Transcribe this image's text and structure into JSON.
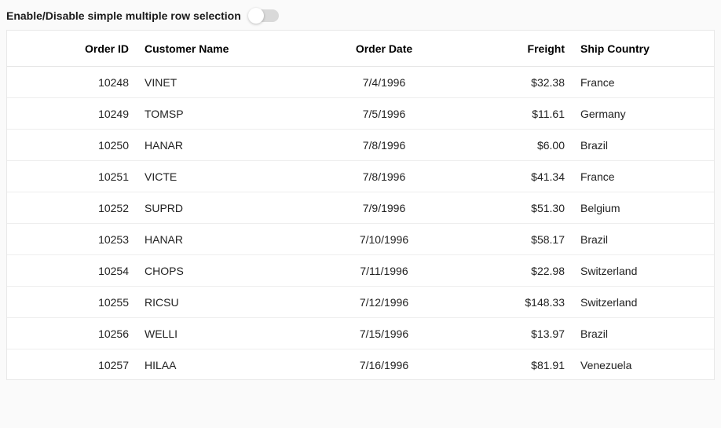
{
  "toggle": {
    "label": "Enable/Disable simple multiple row selection",
    "on": false
  },
  "grid": {
    "columns": {
      "orderId": "Order ID",
      "customer": "Customer Name",
      "orderDate": "Order Date",
      "freight": "Freight",
      "shipCountry": "Ship Country"
    },
    "rows": [
      {
        "orderId": "10248",
        "customer": "VINET",
        "orderDate": "7/4/1996",
        "freight": "$32.38",
        "shipCountry": "France"
      },
      {
        "orderId": "10249",
        "customer": "TOMSP",
        "orderDate": "7/5/1996",
        "freight": "$11.61",
        "shipCountry": "Germany"
      },
      {
        "orderId": "10250",
        "customer": "HANAR",
        "orderDate": "7/8/1996",
        "freight": "$6.00",
        "shipCountry": "Brazil"
      },
      {
        "orderId": "10251",
        "customer": "VICTE",
        "orderDate": "7/8/1996",
        "freight": "$41.34",
        "shipCountry": "France"
      },
      {
        "orderId": "10252",
        "customer": "SUPRD",
        "orderDate": "7/9/1996",
        "freight": "$51.30",
        "shipCountry": "Belgium"
      },
      {
        "orderId": "10253",
        "customer": "HANAR",
        "orderDate": "7/10/1996",
        "freight": "$58.17",
        "shipCountry": "Brazil"
      },
      {
        "orderId": "10254",
        "customer": "CHOPS",
        "orderDate": "7/11/1996",
        "freight": "$22.98",
        "shipCountry": "Switzerland"
      },
      {
        "orderId": "10255",
        "customer": "RICSU",
        "orderDate": "7/12/1996",
        "freight": "$148.33",
        "shipCountry": "Switzerland"
      },
      {
        "orderId": "10256",
        "customer": "WELLI",
        "orderDate": "7/15/1996",
        "freight": "$13.97",
        "shipCountry": "Brazil"
      },
      {
        "orderId": "10257",
        "customer": "HILAA",
        "orderDate": "7/16/1996",
        "freight": "$81.91",
        "shipCountry": "Venezuela"
      }
    ]
  }
}
